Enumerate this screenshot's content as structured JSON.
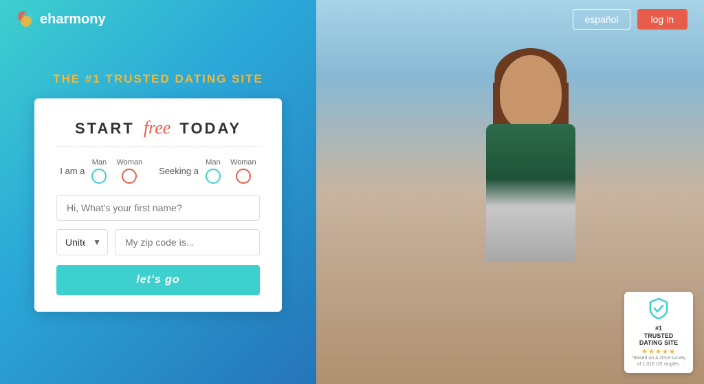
{
  "header": {
    "logo_text": "eharmony",
    "espanol_label": "español",
    "login_label": "log in"
  },
  "left": {
    "tagline_prefix": "THE ",
    "tagline_number": "#1",
    "tagline_suffix": " TRUSTED DATING SITE",
    "form": {
      "title_start": "START",
      "title_free": "free",
      "title_end": "TODAY",
      "i_am_a_label": "I am a",
      "seeking_a_label": "Seeking a",
      "man_label_1": "Man",
      "woman_label_1": "Woman",
      "man_label_2": "Man",
      "woman_label_2": "Woman",
      "first_name_placeholder": "Hi, What's your first name?",
      "country_value": "United States",
      "zip_placeholder": "My zip code is...",
      "submit_label": "let's go"
    }
  },
  "trust_badge": {
    "rank": "#1",
    "line1": "TRUSTED",
    "line2": "DATING SITE",
    "footnote": "*Based on a 2018 survey of 1,016 US singles."
  }
}
